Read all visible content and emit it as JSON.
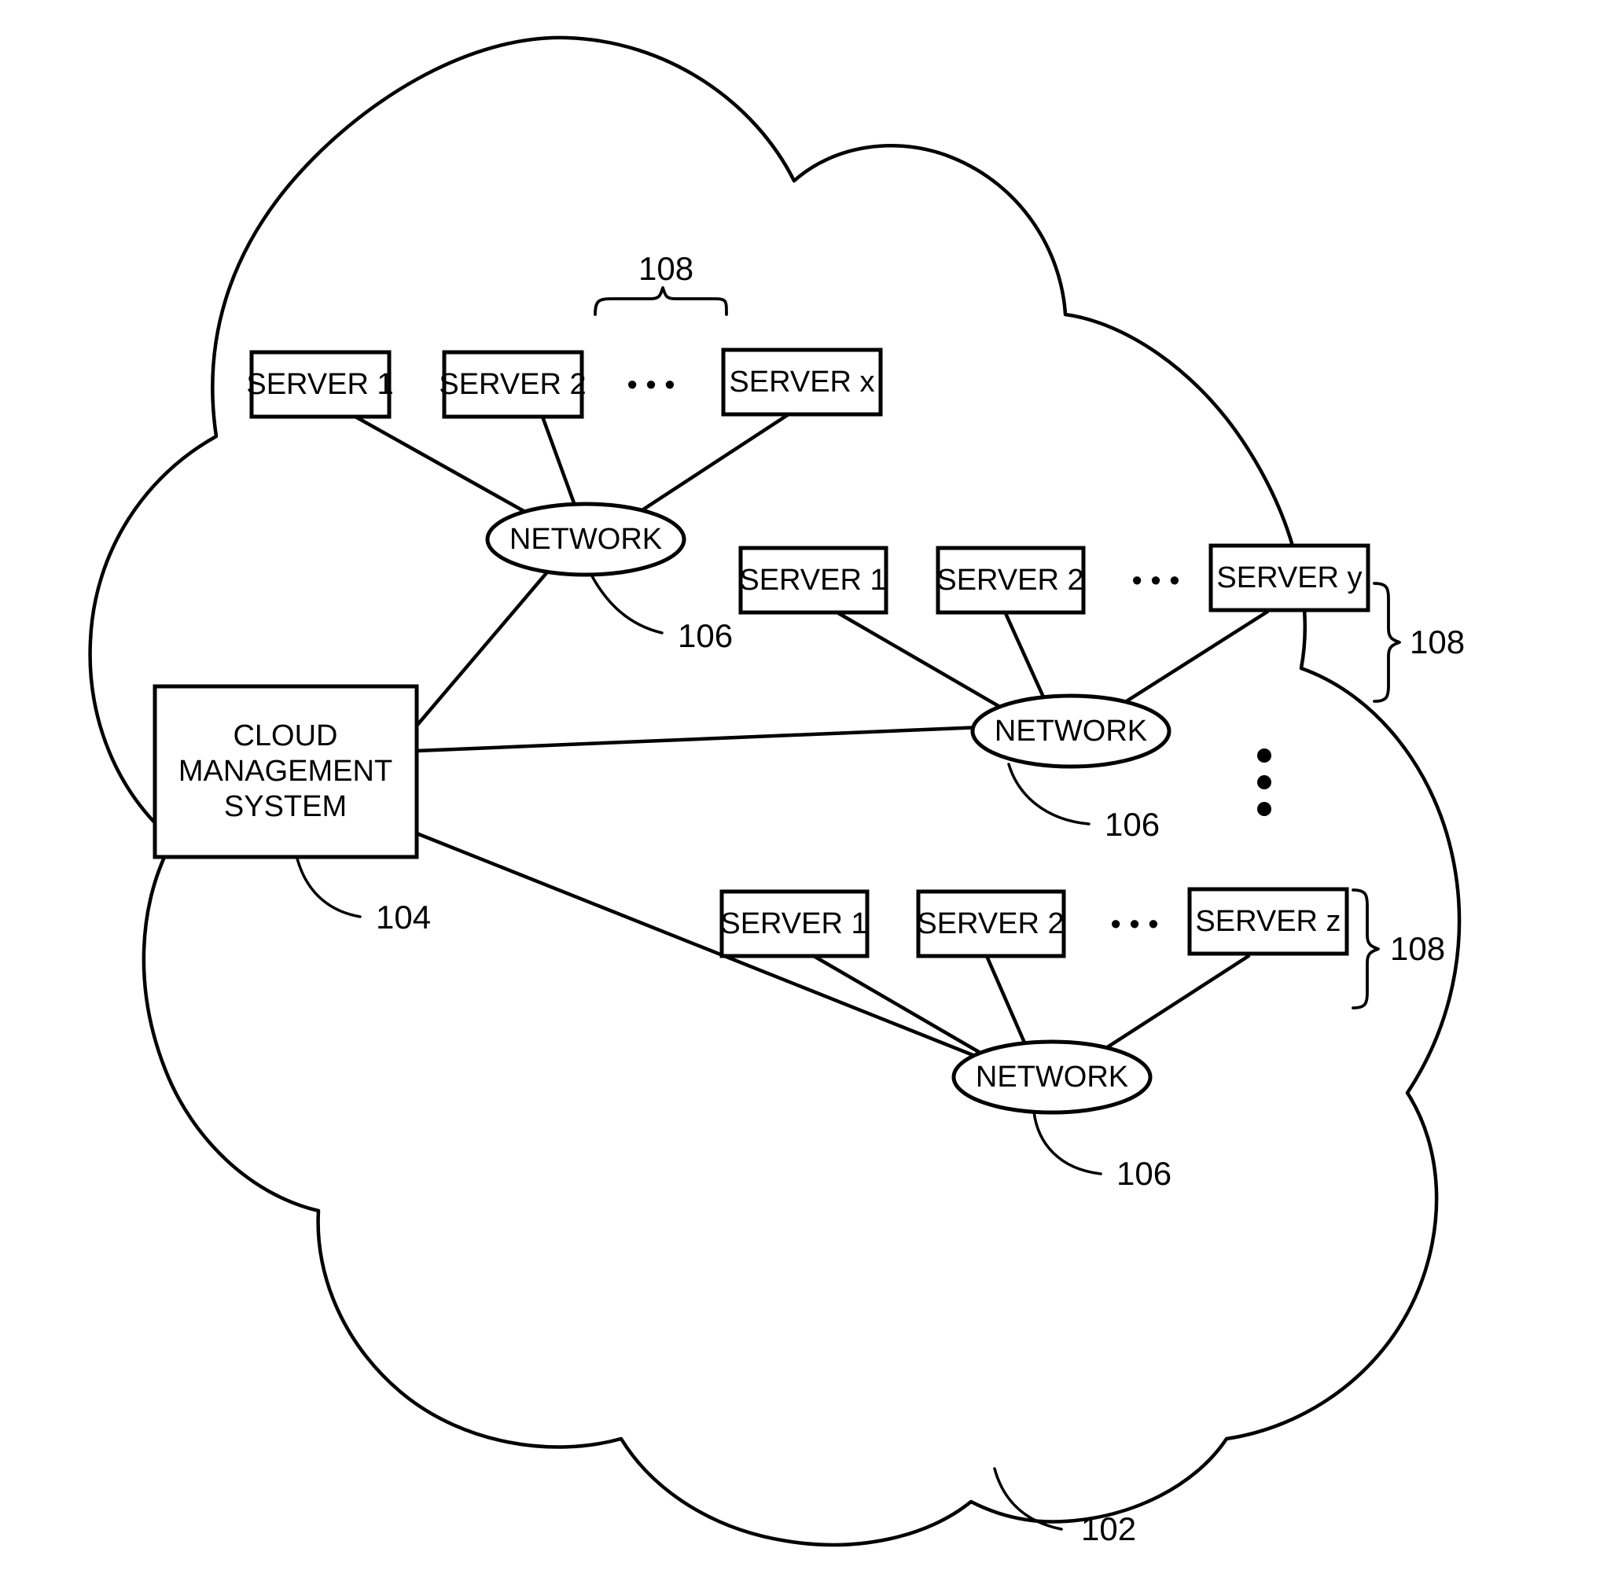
{
  "figure": {
    "title": "Cloud computing system block diagram",
    "stroke_color": "#000000",
    "background_color": "#ffffff"
  },
  "cloud": {
    "label": "102",
    "name": "cloud"
  },
  "cloud_management_system": {
    "line1": "CLOUD",
    "line2": "MANAGEMENT",
    "line3": "SYSTEM",
    "label": "104"
  },
  "groups": [
    {
      "id": "group-top",
      "network": {
        "label": "NETWORK",
        "ref": "106"
      },
      "servers": [
        {
          "label": "SERVER 1"
        },
        {
          "label": "SERVER 2"
        },
        {
          "label": "SERVER x"
        }
      ],
      "ellipsis": "• • •",
      "brace_ref": "108",
      "brace_orientation": "horizontal"
    },
    {
      "id": "group-middle",
      "network": {
        "label": "NETWORK",
        "ref": "106"
      },
      "servers": [
        {
          "label": "SERVER 1"
        },
        {
          "label": "SERVER 2"
        },
        {
          "label": "SERVER y"
        }
      ],
      "ellipsis": "• • •",
      "brace_ref": "108",
      "brace_orientation": "vertical"
    },
    {
      "id": "group-bottom",
      "network": {
        "label": "NETWORK",
        "ref": "106"
      },
      "servers": [
        {
          "label": "SERVER 1"
        },
        {
          "label": "SERVER 2"
        },
        {
          "label": "SERVER z"
        }
      ],
      "ellipsis": "• • •",
      "brace_ref": "108",
      "brace_orientation": "vertical"
    }
  ],
  "vertical_ellipsis": {
    "name": "vertical-ellipsis",
    "dots": 3
  }
}
